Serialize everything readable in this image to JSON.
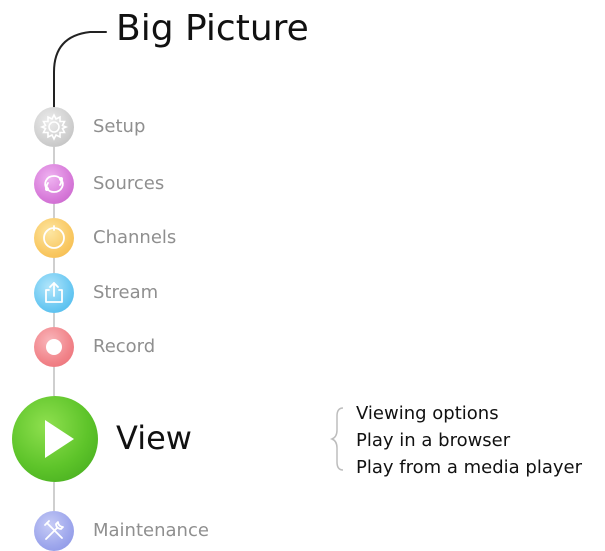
{
  "title": "Big Picture",
  "steps": [
    {
      "label": "Setup",
      "color": "#cfcfcf",
      "icon": "gear-icon"
    },
    {
      "label": "Sources",
      "color": "#d77ad9",
      "icon": "sources-loop-icon"
    },
    {
      "label": "Channels",
      "color": "#f9c862",
      "icon": "channels-ring-icon"
    },
    {
      "label": "Stream",
      "color": "#6ac8f2",
      "icon": "share-upload-icon"
    },
    {
      "label": "Record",
      "color": "#f18389",
      "icon": "record-dot-icon"
    }
  ],
  "view": {
    "label": "View",
    "color": "#5ec42a",
    "icon": "play-icon"
  },
  "maintenance": {
    "label": "Maintenance",
    "color": "#9da6ec",
    "icon": "tools-icon"
  },
  "view_options": [
    "Viewing options",
    "Play in a browser",
    "Play from a media player"
  ]
}
